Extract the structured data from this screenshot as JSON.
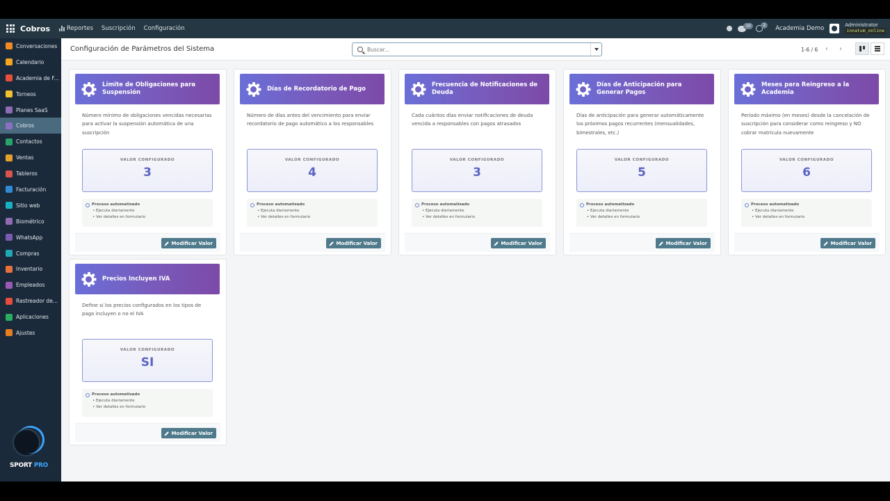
{
  "navbar": {
    "brand": "Cobros",
    "menu": [
      {
        "label": "Reportes"
      },
      {
        "label": "Suscripción"
      },
      {
        "label": "Configuración"
      }
    ],
    "messages_badge": "10",
    "activities_badge": "2",
    "company": "Academia Demo",
    "user": "Administrator",
    "database": "innatum_online"
  },
  "sidebar": {
    "items": [
      {
        "label": "Conversaciones",
        "color": "#f08a24"
      },
      {
        "label": "Calendario",
        "color": "#f5a623"
      },
      {
        "label": "Academia de F...",
        "color": "#e94e3c"
      },
      {
        "label": "Torneos",
        "color": "#f2c12e"
      },
      {
        "label": "Planes SaaS",
        "color": "#8e6bb3"
      },
      {
        "label": "Cobros",
        "color": "#8a6fc2"
      },
      {
        "label": "Contactos",
        "color": "#28a36a"
      },
      {
        "label": "Ventas",
        "color": "#e6a12b"
      },
      {
        "label": "Tableros",
        "color": "#d9534f"
      },
      {
        "label": "Facturación",
        "color": "#2f8bd3"
      },
      {
        "label": "Sitio web",
        "color": "#16b1c4"
      },
      {
        "label": "Biométrico",
        "color": "#8e6bb3"
      },
      {
        "label": "WhatsApp",
        "color": "#7a5bb0"
      },
      {
        "label": "Compras",
        "color": "#21a7b6"
      },
      {
        "label": "Inventario",
        "color": "#e7713a"
      },
      {
        "label": "Empleados",
        "color": "#9b59b6"
      },
      {
        "label": "Rastreador de...",
        "color": "#e74c3c"
      },
      {
        "label": "Aplicaciones",
        "color": "#27ae60"
      },
      {
        "label": "Ajustes",
        "color": "#e67e22"
      }
    ],
    "active_index": 5,
    "logo": {
      "word1": "SPORT",
      "word2": "PRO"
    }
  },
  "control": {
    "title": "Configuración de Parámetros del Sistema",
    "search_placeholder": "Buscar...",
    "pager": "1-6 / 6"
  },
  "card_common": {
    "value_label": "VALOR CONFIGURADO",
    "process_title": "Proceso automatizado",
    "process_line1": "• Ejecuta diariamente",
    "process_line2": "• Ver detalles en formulario",
    "button_label": "Modificar Valor"
  },
  "cards": [
    {
      "title": "Límite de Obligaciones para Suspensión",
      "description": "Número mínimo de obligaciones vencidas necesarias para activar la suspensión automática de una suscripción",
      "value": "3"
    },
    {
      "title": "Días de Recordatorio de Pago",
      "description": "Número de días antes del vencimiento para enviar recordatorio de pago automático a los responsables",
      "value": "4"
    },
    {
      "title": "Frecuencia de Notificaciones de Deuda",
      "description": "Cada cuántos días enviar notificaciones de deuda vencida a responsables con pagos atrasados",
      "value": "3"
    },
    {
      "title": "Días de Anticipación para Generar Pagos",
      "description": "Días de anticipación para generar automáticamente los próximos pagos recurrentes (mensualidades, bimestrales, etc.)",
      "value": "5"
    },
    {
      "title": "Meses para Reingreso a la Academia",
      "description": "Período máximo (en meses) desde la cancelación de suscripción para considerar como reingreso y NO cobrar matrícula nuevamente",
      "value": "6"
    },
    {
      "title": "Precios Incluyen IVA",
      "description": "Define si los precios configurados en los tipos de pago incluyen o no el IVA",
      "value": "SI"
    }
  ]
}
